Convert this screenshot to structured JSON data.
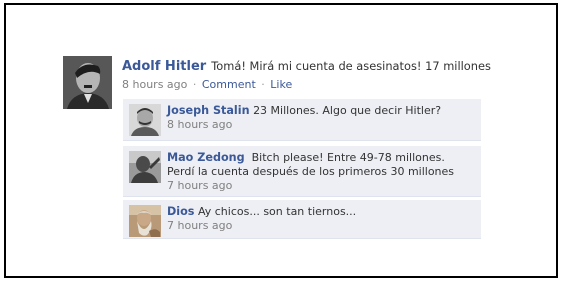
{
  "post": {
    "author": "Adolf  Hitler",
    "text": "Tomá! Mirá mi cuenta de asesinatos! 17 millones",
    "time": "8 hours ago",
    "comment_link": "Comment",
    "like_link": "Like"
  },
  "comments": [
    {
      "author": "Joseph  Stalin",
      "text": "23 Millones. Algo que decir Hitler?",
      "time": "8 hours ago"
    },
    {
      "author": "Mao Zedong",
      "text": "Bitch please! Entre 49-78 millones. Perdí la cuenta después de los primeros 30 millones",
      "time": "7 hours ago"
    },
    {
      "author": "Dios",
      "text": "Ay chicos... son tan tiernos...",
      "time": "7 hours ago"
    }
  ]
}
